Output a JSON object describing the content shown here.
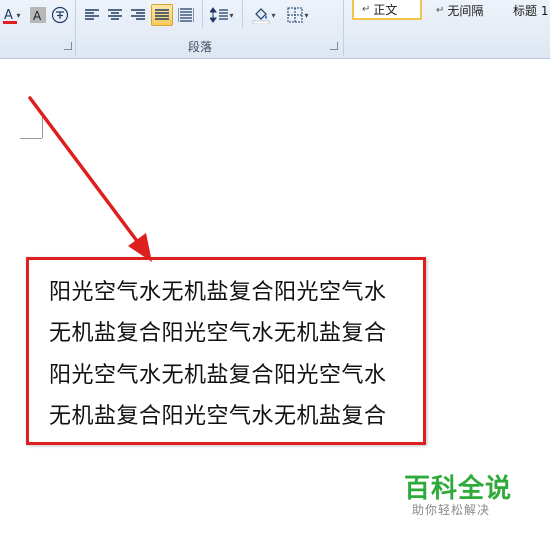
{
  "ribbon": {
    "paragraph_group_label": "段落",
    "styles": [
      {
        "label": "正文",
        "selected": true
      },
      {
        "label": "无间隔",
        "selected": false
      },
      {
        "label": "标题 1",
        "selected": false
      }
    ],
    "style_mark": "↵"
  },
  "document": {
    "lines": [
      "阳光空气水无机盐复合阳光空气水",
      "无机盐复合阳光空气水无机盐复合",
      "阳光空气水无机盐复合阳光空气水",
      "无机盐复合阳光空气水无机盐复合"
    ]
  },
  "watermark": {
    "title": "百科全说",
    "subtitle": "助你轻松解决"
  },
  "colors": {
    "highlight_border": "#dd1f1f",
    "arrow": "#dd1f1f",
    "watermark_green": "#2daa3a",
    "active_button": "#f7c95a"
  }
}
